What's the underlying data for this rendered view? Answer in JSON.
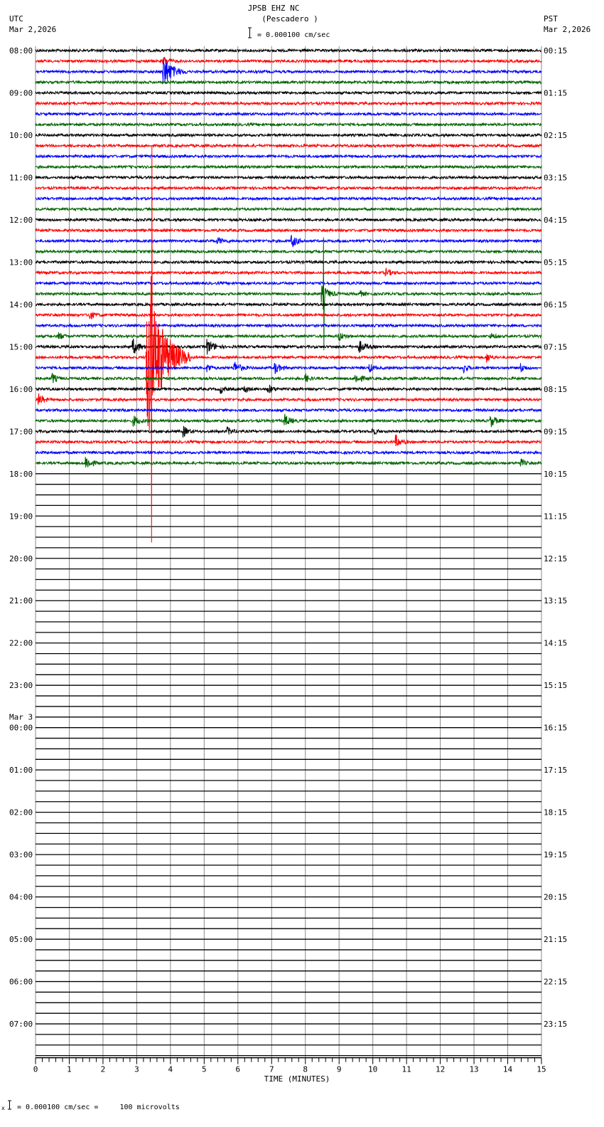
{
  "header": {
    "title": "JPSB EHZ NC",
    "subtitle": "(Pescadero )",
    "left_tz": "UTC",
    "left_date": "Mar 2,2026",
    "right_tz": "PST",
    "right_date": "Mar 2,2026",
    "scale_label": "= 0.000100 cm/sec"
  },
  "footer": {
    "scale_label": "= 0.000100 cm/sec =     100 microvolts",
    "marker": "x"
  },
  "chart_data": {
    "type": "line",
    "subtype": "helicorder",
    "xlabel": "TIME (MINUTES)",
    "xlim": [
      0,
      15
    ],
    "x_ticks": [
      "0",
      "1",
      "2",
      "3",
      "4",
      "5",
      "6",
      "7",
      "8",
      "9",
      "10",
      "11",
      "12",
      "13",
      "14",
      "15"
    ],
    "rows_total": 96,
    "rows_with_data": 40,
    "trace_colors": [
      "#000000",
      "#ff0000",
      "#0000ff",
      "#006400"
    ],
    "left_labels": [
      "08:00",
      "09:00",
      "10:00",
      "11:00",
      "12:00",
      "13:00",
      "14:00",
      "15:00",
      "16:00",
      "17:00",
      "18:00",
      "19:00",
      "20:00",
      "21:00",
      "22:00",
      "23:00",
      "00:00",
      "01:00",
      "02:00",
      "03:00",
      "04:00",
      "05:00",
      "06:00",
      "07:00"
    ],
    "date_change_label": "Mar 3",
    "right_labels": [
      "00:15",
      "01:15",
      "02:15",
      "03:15",
      "04:15",
      "05:15",
      "06:15",
      "07:15",
      "08:15",
      "09:15",
      "10:15",
      "11:15",
      "12:15",
      "13:15",
      "14:15",
      "15:15",
      "16:15",
      "17:15",
      "18:15",
      "19:15",
      "20:15",
      "21:15",
      "22:15",
      "23:15"
    ],
    "events": [
      {
        "row": 2,
        "minute": 3.8,
        "amplitude": 22,
        "duration": 0.7
      },
      {
        "row": 1,
        "minute": 3.8,
        "amplitude": 6,
        "duration": 0.4
      },
      {
        "row": 18,
        "minute": 5.4,
        "amplitude": 5,
        "duration": 0.4
      },
      {
        "row": 18,
        "minute": 7.6,
        "amplitude": 9,
        "duration": 0.4
      },
      {
        "row": 21,
        "minute": 10.4,
        "amplitude": 5,
        "duration": 0.4
      },
      {
        "row": 23,
        "minute": 8.5,
        "amplitude": 12,
        "duration": 0.5
      },
      {
        "row": 23,
        "minute": 8.55,
        "amplitude": 70,
        "duration": 0.02
      },
      {
        "row": 23,
        "minute": 9.6,
        "amplitude": 5,
        "duration": 0.3
      },
      {
        "row": 25,
        "minute": 1.6,
        "amplitude": 6,
        "duration": 0.4
      },
      {
        "row": 27,
        "minute": 0.7,
        "amplitude": 5,
        "duration": 0.3
      },
      {
        "row": 27,
        "minute": 9.0,
        "amplitude": 6,
        "duration": 0.4
      },
      {
        "row": 27,
        "minute": 13.5,
        "amplitude": 4,
        "duration": 0.3
      },
      {
        "row": 28,
        "minute": 2.9,
        "amplitude": 10,
        "duration": 0.5
      },
      {
        "row": 28,
        "minute": 5.1,
        "amplitude": 10,
        "duration": 0.5
      },
      {
        "row": 28,
        "minute": 9.6,
        "amplitude": 8,
        "duration": 0.5
      },
      {
        "row": 29,
        "minute": 3.3,
        "amplitude": 120,
        "duration": 1.3
      },
      {
        "row": 29,
        "minute": 3.45,
        "amplitude": 220,
        "duration": 0.03
      },
      {
        "row": 29,
        "minute": 13.4,
        "amplitude": 6,
        "duration": 0.3
      },
      {
        "row": 30,
        "minute": 5.1,
        "amplitude": 6,
        "duration": 0.3
      },
      {
        "row": 30,
        "minute": 5.9,
        "amplitude": 8,
        "duration": 0.5
      },
      {
        "row": 30,
        "minute": 7.1,
        "amplitude": 8,
        "duration": 0.4
      },
      {
        "row": 30,
        "minute": 9.9,
        "amplitude": 6,
        "duration": 0.3
      },
      {
        "row": 30,
        "minute": 12.7,
        "amplitude": 6,
        "duration": 0.3
      },
      {
        "row": 30,
        "minute": 14.4,
        "amplitude": 6,
        "duration": 0.3
      },
      {
        "row": 31,
        "minute": 0.5,
        "amplitude": 7,
        "duration": 0.3
      },
      {
        "row": 31,
        "minute": 8.0,
        "amplitude": 6,
        "duration": 0.3
      },
      {
        "row": 31,
        "minute": 9.5,
        "amplitude": 6,
        "duration": 0.5
      },
      {
        "row": 32,
        "minute": 5.5,
        "amplitude": 5,
        "duration": 0.3
      },
      {
        "row": 32,
        "minute": 6.2,
        "amplitude": 5,
        "duration": 0.3
      },
      {
        "row": 32,
        "minute": 6.9,
        "amplitude": 7,
        "duration": 0.3
      },
      {
        "row": 33,
        "minute": 0.1,
        "amplitude": 8,
        "duration": 0.4
      },
      {
        "row": 35,
        "minute": 2.9,
        "amplitude": 7,
        "duration": 0.5
      },
      {
        "row": 35,
        "minute": 7.4,
        "amplitude": 8,
        "duration": 0.4
      },
      {
        "row": 35,
        "minute": 13.5,
        "amplitude": 8,
        "duration": 0.4
      },
      {
        "row": 36,
        "minute": 4.4,
        "amplitude": 7,
        "duration": 0.3
      },
      {
        "row": 36,
        "minute": 5.7,
        "amplitude": 5,
        "duration": 0.4
      },
      {
        "row": 36,
        "minute": 10.0,
        "amplitude": 5,
        "duration": 0.3
      },
      {
        "row": 37,
        "minute": 10.7,
        "amplitude": 8,
        "duration": 0.4
      },
      {
        "row": 39,
        "minute": 1.5,
        "amplitude": 10,
        "duration": 0.4
      },
      {
        "row": 39,
        "minute": 14.4,
        "amplitude": 5,
        "duration": 0.3
      }
    ]
  }
}
